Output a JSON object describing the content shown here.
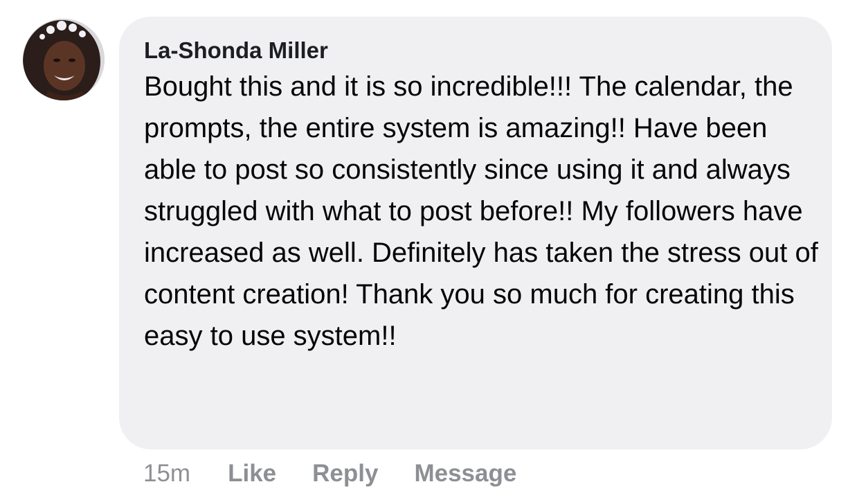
{
  "comment": {
    "author": "La-Shonda Miller",
    "text": "Bought this and it is so incredible!!! The calendar, the prompts, the entire system is amazing!! Have been able to post so consistently since using it and always struggled with what to post before!! My followers have increased as well. Definitely has taken the stress out of content creation! Thank you so much for creating this easy to use system!!",
    "timestamp": "15m",
    "actions": {
      "like": "Like",
      "reply": "Reply",
      "message": "Message"
    }
  },
  "colors": {
    "bubble_background": "#f0f0f3",
    "author_text": "#1c1e21",
    "body_text": "#050505",
    "action_text": "#8d8f94"
  }
}
